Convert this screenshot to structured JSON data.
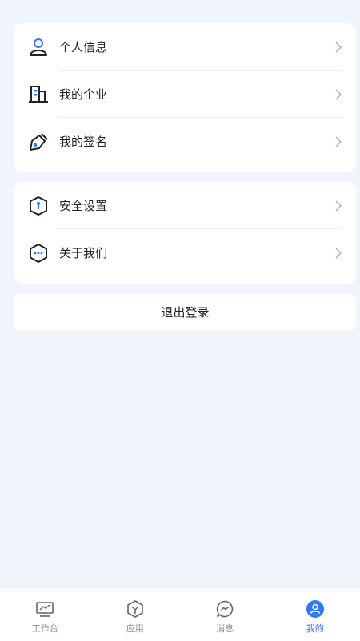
{
  "menu_group_1": [
    {
      "label": "个人信息",
      "icon": "user-icon"
    },
    {
      "label": "我的企业",
      "icon": "building-icon"
    },
    {
      "label": "我的签名",
      "icon": "signature-pen-icon"
    }
  ],
  "menu_group_2": [
    {
      "label": "安全设置",
      "icon": "shield-key-icon"
    },
    {
      "label": "关于我们",
      "icon": "info-hexagon-icon"
    }
  ],
  "logout_label": "退出登录",
  "tabs": [
    {
      "label": "工作台",
      "icon": "workbench-icon",
      "active": false
    },
    {
      "label": "应用",
      "icon": "apps-icon",
      "active": false
    },
    {
      "label": "消息",
      "icon": "message-icon",
      "active": false
    },
    {
      "label": "我的",
      "icon": "profile-icon",
      "active": true
    }
  ],
  "colors": {
    "accent": "#3277f5",
    "text": "#1f2329",
    "muted": "#8a8f99",
    "background": "#f0f4fb"
  }
}
